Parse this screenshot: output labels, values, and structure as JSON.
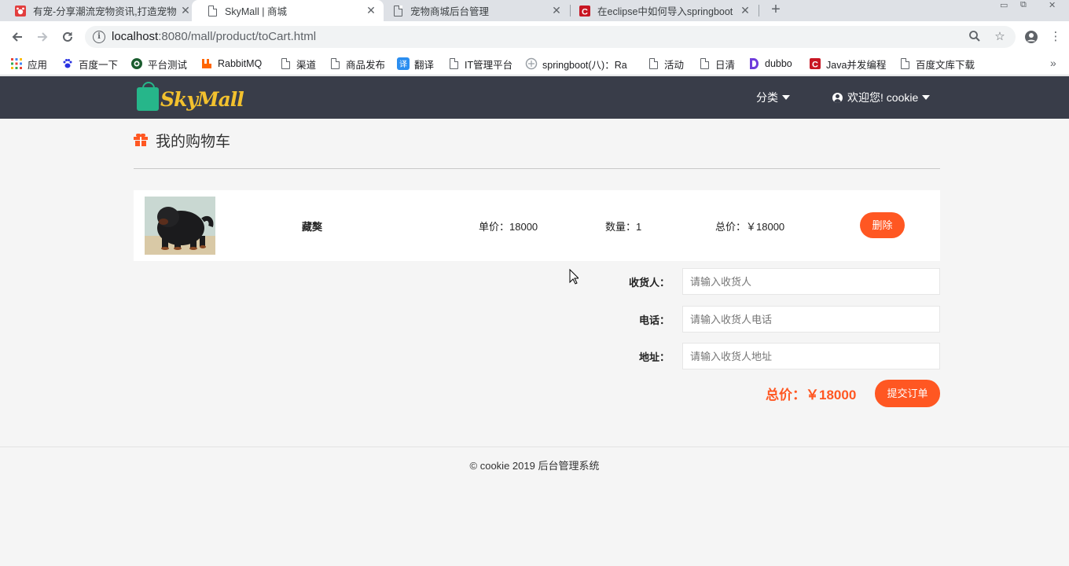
{
  "browser": {
    "tabs": [
      {
        "title": "有宠-分享潮流宠物资讯,打造宠物",
        "active": false
      },
      {
        "title": "SkyMall | 商城",
        "active": true
      },
      {
        "title": "宠物商城后台管理",
        "active": false
      },
      {
        "title": "在eclipse中如何导入springboot",
        "active": false
      }
    ],
    "url_host": "localhost",
    "url_rest": ":8080/mall/product/toCart.html",
    "bookmarks": [
      {
        "label": "应用",
        "icon": "apps-grid-icon"
      },
      {
        "label": "百度一下",
        "icon": "baidu-paw-icon"
      },
      {
        "label": "平台测试",
        "icon": "globe-icon"
      },
      {
        "label": "RabbitMQ",
        "icon": "rabbitmq-icon"
      },
      {
        "label": "渠道",
        "icon": "document-icon"
      },
      {
        "label": "商品发布",
        "icon": "document-icon"
      },
      {
        "label": "翻译",
        "icon": "translate-icon"
      },
      {
        "label": "IT管理平台",
        "icon": "document-icon"
      },
      {
        "label": "springboot(八)：Ra",
        "icon": "springboot-icon"
      },
      {
        "label": "活动",
        "icon": "document-icon"
      },
      {
        "label": "日清",
        "icon": "document-icon"
      },
      {
        "label": "dubbo",
        "icon": "dubbo-icon"
      },
      {
        "label": "Java并发编程",
        "icon": "csdn-icon"
      },
      {
        "label": "百度文库下载",
        "icon": "document-icon"
      }
    ]
  },
  "header": {
    "logo_text": "SkyMall",
    "category_label": "分类",
    "user_label": "欢迎您! cookie"
  },
  "page": {
    "title": "我的购物车"
  },
  "cart": {
    "items": [
      {
        "name": "藏獒",
        "unit_price_label": "单价：18000",
        "quantity_label": "数量：1",
        "total_label": "总价：￥18000",
        "delete_label": "删除"
      }
    ]
  },
  "form": {
    "receiver_label": "收货人：",
    "receiver_placeholder": "请输入收货人",
    "phone_label": "电话：",
    "phone_placeholder": "请输入收货人电话",
    "address_label": "地址：",
    "address_placeholder": "请输入收货人地址",
    "total_label": "总价：￥18000",
    "submit_label": "提交订单"
  },
  "footer": {
    "text": "© cookie 2019  后台管理系统"
  },
  "colors": {
    "accent": "#ff5722",
    "header_bg": "#393d49",
    "logo_text": "#f2c12e",
    "logo_bag": "#26b68a"
  }
}
